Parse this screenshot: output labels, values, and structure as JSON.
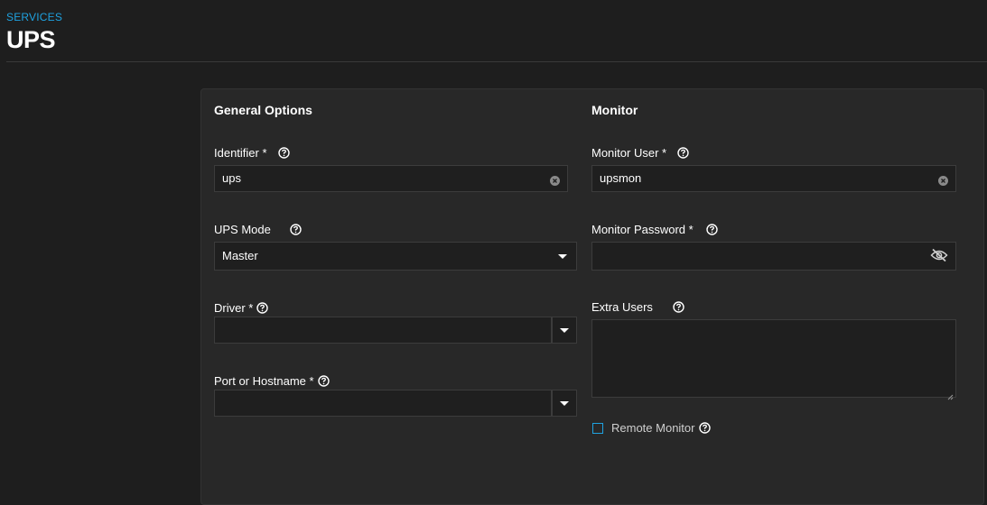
{
  "header": {
    "breadcrumb": "SERVICES",
    "title": "UPS"
  },
  "general": {
    "title": "General Options",
    "identifier": {
      "label": "Identifier *",
      "value": "ups"
    },
    "ups_mode": {
      "label": "UPS Mode",
      "value": "Master"
    },
    "driver": {
      "label": "Driver *",
      "value": ""
    },
    "port": {
      "label": "Port or Hostname *",
      "value": ""
    }
  },
  "monitor": {
    "title": "Monitor",
    "user": {
      "label": "Monitor User *",
      "value": "upsmon"
    },
    "password": {
      "label": "Monitor Password *",
      "value": ""
    },
    "extra_users": {
      "label": "Extra Users",
      "value": ""
    },
    "remote_monitor": {
      "label": "Remote Monitor",
      "checked": false
    }
  },
  "colors": {
    "accent": "#1fa2e0",
    "background": "#1e1e1e",
    "card": "#282828",
    "input": "#1f1f1f"
  },
  "icons": [
    "help-icon",
    "clear-icon",
    "chevron-down-icon",
    "eye-off-icon"
  ]
}
